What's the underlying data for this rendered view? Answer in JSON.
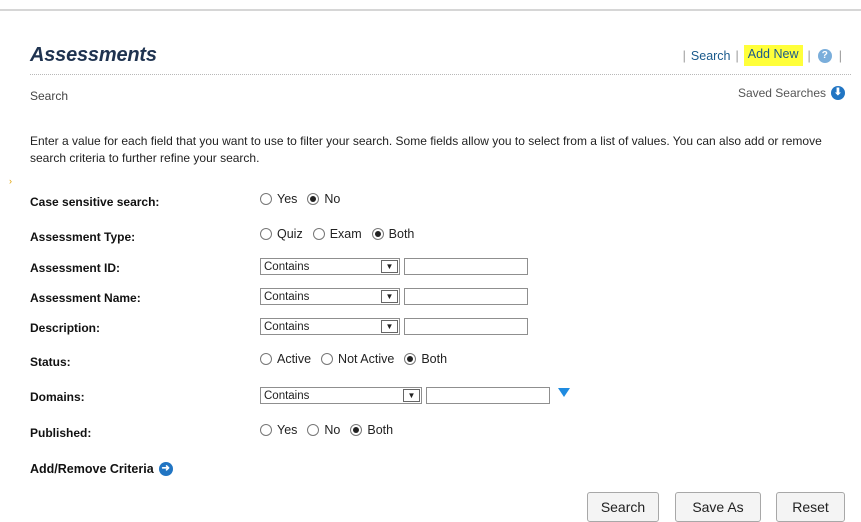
{
  "header": {
    "title": "Assessments",
    "search_link": "Search",
    "add_new_link": "Add New",
    "help_icon": "?",
    "sub_title": "Search",
    "saved_searches": "Saved Searches"
  },
  "instructions": "Enter a value for each field that you want to use to filter your search. Some fields allow you to select from a list of values. You can also add or remove search criteria to further refine your search.",
  "fields": {
    "case_sensitive": {
      "label": "Case sensitive search:",
      "options": [
        "Yes",
        "No"
      ],
      "selected": "No"
    },
    "assessment_type": {
      "label": "Assessment Type:",
      "options": [
        "Quiz",
        "Exam",
        "Both"
      ],
      "selected": "Both"
    },
    "assessment_id": {
      "label": "Assessment ID:",
      "operator": "Contains",
      "value": ""
    },
    "assessment_name": {
      "label": "Assessment Name:",
      "operator": "Contains",
      "value": ""
    },
    "description": {
      "label": "Description:",
      "operator": "Contains",
      "value": ""
    },
    "status": {
      "label": "Status:",
      "options": [
        "Active",
        "Not Active",
        "Both"
      ],
      "selected": "Both"
    },
    "domains": {
      "label": "Domains:",
      "operator": "Contains",
      "value": ""
    },
    "published": {
      "label": "Published:",
      "options": [
        "Yes",
        "No",
        "Both"
      ],
      "selected": "Both"
    }
  },
  "add_remove_criteria": "Add/Remove Criteria",
  "buttons": {
    "search": "Search",
    "save_as": "Save As",
    "reset": "Reset"
  },
  "icons": {
    "help": "help-circle-icon",
    "saved_searches": "down-arrow-circle-icon",
    "filter": "filter-icon",
    "add_remove": "right-arrow-circle-icon"
  },
  "colors": {
    "title": "#1f3350",
    "link": "#1a5a8c",
    "highlight": "#ffff3a",
    "accent": "#2175c3"
  }
}
